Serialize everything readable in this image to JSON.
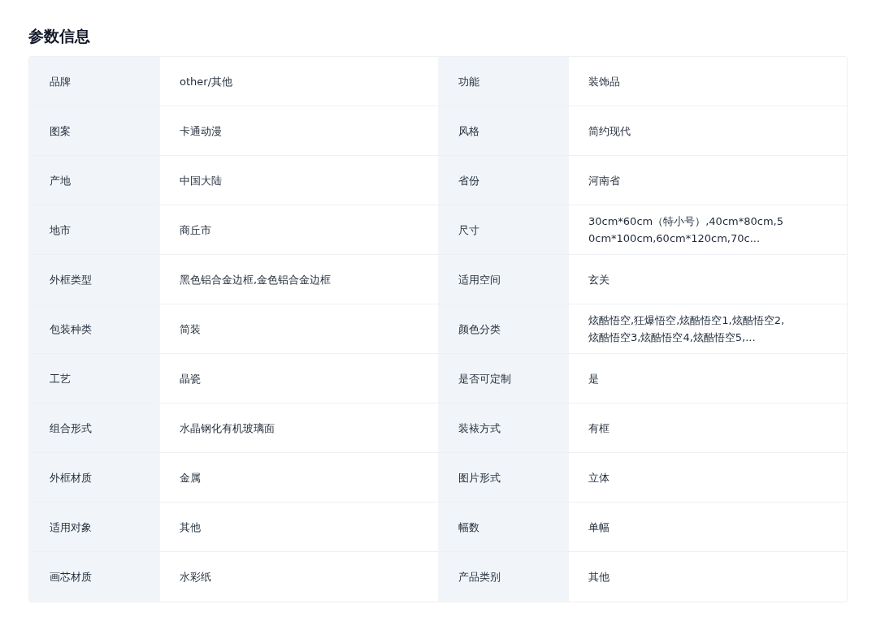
{
  "title": "参数信息",
  "rows": [
    {
      "cells": [
        {
          "label": "品牌",
          "value": "other/其他"
        },
        {
          "label": "功能",
          "value": "装饰品"
        }
      ]
    },
    {
      "cells": [
        {
          "label": "图案",
          "value": "卡通动漫"
        },
        {
          "label": "风格",
          "value": "简约现代"
        }
      ]
    },
    {
      "cells": [
        {
          "label": "产地",
          "value": "中国大陆"
        },
        {
          "label": "省份",
          "value": "河南省"
        }
      ]
    },
    {
      "cells": [
        {
          "label": "地市",
          "value": "商丘市"
        },
        {
          "label": "尺寸",
          "value": "30cm*60cm（特小号）,40cm*80cm,50cm*100cm,60cm*120cm,70c..."
        }
      ]
    },
    {
      "cells": [
        {
          "label": "外框类型",
          "value": "黑色铝合金边框,金色铝合金边框"
        },
        {
          "label": "适用空间",
          "value": "玄关"
        }
      ]
    },
    {
      "cells": [
        {
          "label": "包装种类",
          "value": "简装"
        },
        {
          "label": "颜色分类",
          "value": "炫酷悟空,狂爆悟空,炫酷悟空1,炫酷悟空2,炫酷悟空3,炫酷悟空4,炫酷悟空5,..."
        }
      ]
    },
    {
      "cells": [
        {
          "label": "工艺",
          "value": "晶瓷"
        },
        {
          "label": "是否可定制",
          "value": "是"
        }
      ]
    },
    {
      "cells": [
        {
          "label": "组合形式",
          "value": "水晶钢化有机玻璃面"
        },
        {
          "label": "装裱方式",
          "value": "有框"
        }
      ]
    },
    {
      "cells": [
        {
          "label": "外框材质",
          "value": "金属"
        },
        {
          "label": "图片形式",
          "value": "立体"
        }
      ]
    },
    {
      "cells": [
        {
          "label": "适用对象",
          "value": "其他"
        },
        {
          "label": "幅数",
          "value": "单幅"
        }
      ]
    },
    {
      "cells": [
        {
          "label": "画芯材质",
          "value": "水彩纸"
        },
        {
          "label": "产品类别",
          "value": "其他"
        }
      ]
    }
  ]
}
